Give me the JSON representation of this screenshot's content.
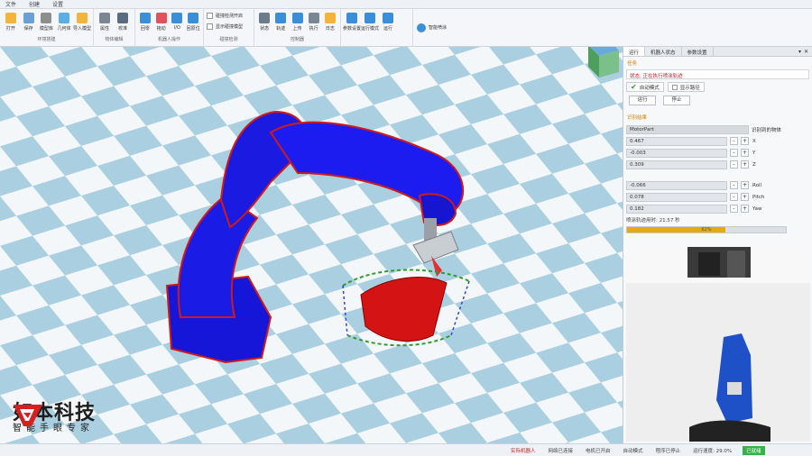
{
  "menu": [
    "文件",
    "创建",
    "设置"
  ],
  "ribbon": {
    "groups": [
      {
        "name": "环境搭建",
        "buttons": [
          {
            "label": "打开",
            "icon": "folder-icon",
            "color": "#f2b43a"
          },
          {
            "label": "保存",
            "icon": "save-icon",
            "color": "#6aa0d6"
          },
          {
            "label": "模型库",
            "icon": "library-icon",
            "color": "#8e8e8e"
          },
          {
            "label": "几何体",
            "icon": "cube-icon",
            "color": "#5aaee6"
          },
          {
            "label": "导入模型",
            "icon": "import-icon",
            "color": "#f2b43a"
          }
        ]
      },
      {
        "name": "物体编辑",
        "buttons": [
          {
            "label": "属性",
            "icon": "properties-icon",
            "color": "#7a8694"
          },
          {
            "label": "校准",
            "icon": "calibrate-icon",
            "color": "#5a6d80"
          }
        ]
      },
      {
        "name": "机器人操作",
        "buttons": [
          {
            "label": "回零",
            "icon": "home-icon",
            "color": "#3a8fd8"
          },
          {
            "label": "拖动",
            "icon": "drag-icon",
            "color": "#e2525c"
          },
          {
            "label": "I/O",
            "icon": "io-icon",
            "color": "#3a8fd8"
          },
          {
            "label": "回原位",
            "icon": "reset-icon",
            "color": "#3a8fd8"
          }
        ]
      },
      {
        "name": "碰撞检测",
        "checks": [
          "碰撞检测开启",
          "显示碰撞模型"
        ]
      },
      {
        "name": "控制器",
        "buttons": [
          {
            "label": "状态",
            "icon": "status-icon",
            "color": "#6b7b8c"
          },
          {
            "label": "轨迹",
            "icon": "trajectory-icon",
            "color": "#3a8fd8"
          },
          {
            "label": "上传",
            "icon": "upload-icon",
            "color": "#3a8fd8"
          },
          {
            "label": "执行",
            "icon": "execute-icon",
            "color": "#7a8694"
          },
          {
            "label": "日志",
            "icon": "log-icon",
            "color": "#f2b43a"
          }
        ]
      },
      {
        "name": "",
        "buttons": [
          {
            "label": "参数设置",
            "icon": "params-icon",
            "color": "#3a8fd8"
          },
          {
            "label": "运行模式",
            "icon": "mode-icon",
            "color": "#3a8fd8"
          },
          {
            "label": "运行",
            "icon": "run-icon",
            "color": "#3a8fd8"
          }
        ]
      }
    ],
    "extra_label": "智能喷涂"
  },
  "panel": {
    "tabs": [
      "运行",
      "机器人状态",
      "参数设置"
    ],
    "section_task": "任务",
    "status_text": "状态: 正在执行喷涂轨迹",
    "mode_auto": "自动模式",
    "mode_show": "显示路径",
    "run_btn": "运行",
    "stop_btn": "停止",
    "section_result": "识别结果",
    "part_name": "MotorPart",
    "part_label": "识别到的物体",
    "coords": [
      {
        "value": "0.467",
        "label": "X"
      },
      {
        "value": "-0.003",
        "label": "Y"
      },
      {
        "value": "0.309",
        "label": "Z"
      },
      {
        "value": "-0.066",
        "label": "Roll"
      },
      {
        "value": "0.078",
        "label": "Pitch"
      },
      {
        "value": "0.182",
        "label": "Yaw"
      }
    ],
    "remaining": "喷涂轨迹用时: 21.57 秒",
    "progress": 62,
    "progress_text": "62%"
  },
  "logo": {
    "title": "如本科技",
    "subtitle": "智能手眼专家"
  },
  "statusbar": {
    "real_robot": "实际机器人",
    "net": "网络已连接",
    "motor": "电机已开启",
    "auto": "自动模式",
    "program": "程序已停止",
    "speed": "运行速度: 29.0%",
    "ok": "已就绪"
  }
}
